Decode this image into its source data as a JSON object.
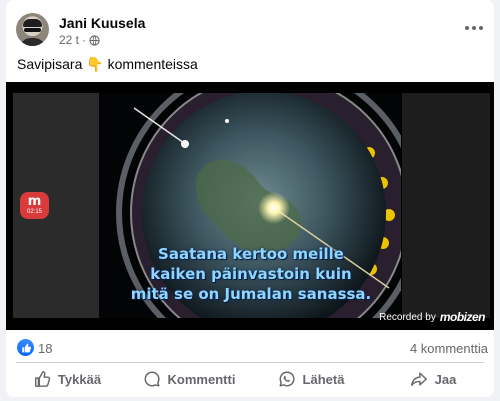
{
  "post": {
    "author": "Jani Kuusela",
    "time": "22 t",
    "separator": "·",
    "text": "Savipisara 👇 kommenteissa",
    "privacy_icon": "globe-icon",
    "menu_icon": "more-options-icon"
  },
  "video": {
    "caption_lines": [
      "Saatana kertoo meille",
      "kaiken päinvastoin kuin",
      "mitä se on Jumalan sanassa."
    ],
    "recorded_label": "Recorded by",
    "recorded_brand": "mobizen",
    "badge_timer": "02:15"
  },
  "stats": {
    "like_count": "18",
    "comment_count": "4 kommenttia"
  },
  "actions": {
    "like": "Tykkää",
    "comment": "Kommentti",
    "send": "Lähetä",
    "share": "Jaa"
  },
  "colors": {
    "brand_blue": "#0866ff",
    "secondary_text": "#65676b",
    "caption": "#8fd6ff"
  }
}
